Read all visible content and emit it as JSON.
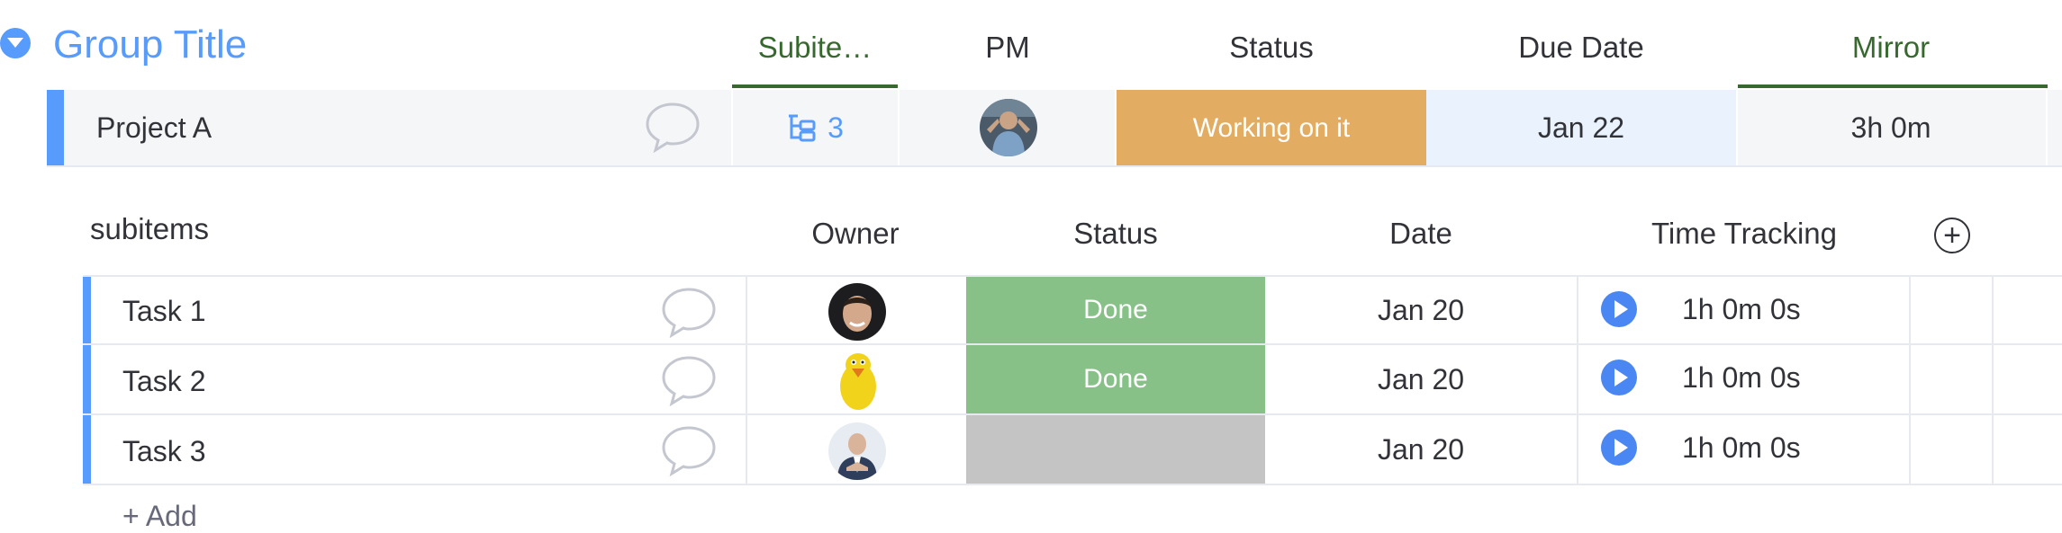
{
  "group": {
    "title": "Group Title"
  },
  "columns": {
    "subitems": "Subite…",
    "pm": "PM",
    "status": "Status",
    "due_date": "Due Date",
    "mirror": "Mirror"
  },
  "item": {
    "name": "Project A",
    "subitems_count": "3",
    "status": "Working on it",
    "status_color": "#e2ad62",
    "due_date": "Jan 22",
    "mirror": "3h 0m"
  },
  "subitems": {
    "headers": {
      "name": "subitems",
      "owner": "Owner",
      "status": "Status",
      "date": "Date",
      "time_tracking": "Time Tracking"
    },
    "rows": [
      {
        "name": "Task 1",
        "status": "Done",
        "status_color": "#87c188",
        "date": "Jan 20",
        "time": "1h 0m 0s"
      },
      {
        "name": "Task 2",
        "status": "Done",
        "status_color": "#87c188",
        "date": "Jan 20",
        "time": "1h 0m 0s"
      },
      {
        "name": "Task 3",
        "status": "",
        "status_color": "#c4c4c4",
        "date": "Jan 20",
        "time": "1h 0m 0s"
      }
    ],
    "add_label": "+ Add"
  },
  "colors": {
    "accent": "#579bfc",
    "mirror_green": "#37692f",
    "working": "#e2ad62",
    "done": "#87c188",
    "empty": "#c4c4c4"
  }
}
